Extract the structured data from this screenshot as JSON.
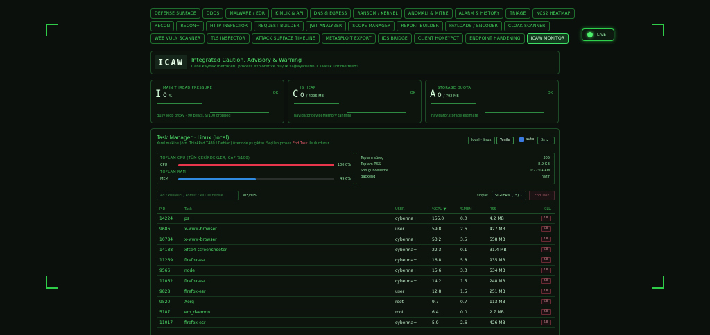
{
  "nav": {
    "rows": [
      [
        "DEFENSE SURFACE",
        "DDOS",
        "MALWARE / EDR",
        "KIMLIK & API",
        "DNS & EGRESS",
        "RANSOM / KERNEL",
        "ANOMALI & MITRE",
        "ALARM & HISTORY",
        "TRIAGE",
        "NCS2 HEATMAP"
      ],
      [
        "RECON",
        "RECON+",
        "HTTP INSPECTOR",
        "REQUEST BUILDER",
        "JWT ANALYZER",
        "SCOPE MANAGER",
        "REPORT BUILDER",
        "PAYLOADS / ENCODER",
        "CLOAK SCANNER"
      ],
      [
        "WEB VULN SCANNER",
        "TLS INSPECTOR",
        "ATTACK SURFACE TIMELINE",
        "METASPLOIT EXPORT",
        "IDS BRIDGE",
        "CLIENT HONEYPOT",
        "ENDPOINT HARDENING",
        "ICAW MONITOR"
      ]
    ],
    "active": "ICAW MONITOR"
  },
  "live": {
    "label": "LIVE"
  },
  "icaw": {
    "logo": "ICAW",
    "title": "Integrated Caution, Advisory & Warning",
    "subtitle": "Canlı kaynak metrikleri, process explorer ve büyük sağlayıcıların 1 saatlik uptime feed'i."
  },
  "gauges": [
    {
      "letter": "I",
      "label": "MAIN THREAD PRESSURE",
      "value": "0",
      "unit": "%",
      "status": "OK",
      "note": "Busy loop proxy · 90 beats, 9/100 dropped"
    },
    {
      "letter": "C",
      "label": "JS HEAP",
      "value": "0",
      "unit": "/ 4096 MB",
      "status": "OK",
      "note": "navigator.deviceMemory tahmini"
    },
    {
      "letter": "A",
      "label": "STORAGE QUOTA",
      "value": "0",
      "unit": "/ 792 MB",
      "status": "OK",
      "note": "navigator.storage.estimate"
    }
  ],
  "task_manager": {
    "title": "Task Manager · Linux (local)",
    "subtitle_pre": "Yerel makine (örn. ThinkPad T480 / Debian) üzerinde ps çıktısı. Seçilen proses ",
    "subtitle_hl": "End Task",
    "subtitle_post": " ile durdurur.",
    "source_chip": "local · linux",
    "refresh_btn": "Yenile",
    "auto_label": "auto",
    "interval": "3s",
    "totals": {
      "cpu_head": "TOPLAM CPU (TÜM ÇEKİRDEKLER, CAP %100)",
      "cpu_label": "CPU",
      "cpu_pct": 100.0,
      "cpu_text": "100.0%",
      "ram_head": "TOPLAM RAM",
      "ram_label": "MEM",
      "ram_pct": 49.6,
      "ram_text": "49.6%",
      "cpu_color": "#e8364d",
      "ram_color": "#2f8ae0"
    },
    "stats": [
      {
        "label": "Toplam süreç",
        "value": "305"
      },
      {
        "label": "Toplam RSS",
        "value": "8.9 GB"
      },
      {
        "label": "Son güncelleme",
        "value": "1:22:14 AM"
      },
      {
        "label": "Backend",
        "value": "hazır"
      }
    ],
    "filter_placeholder": "Ad / kullanıcı / komut / PID ile filtrele",
    "count": "305/305",
    "signal_label": "sinyal:",
    "signal_value": "SIGTERM (15)",
    "end_task": "End Task",
    "columns": {
      "pid": "PID",
      "task": "Task",
      "user": "USER",
      "cpu": "%CPU ▼",
      "mem": "%MEM",
      "rss": "RSS",
      "kill": "KILL"
    },
    "kill_label": "Kill",
    "rows": [
      {
        "pid": "14224",
        "task": "ps",
        "user": "cyberma+",
        "cpu": "155.0",
        "mem": "0.0",
        "rss": "4.2 MB"
      },
      {
        "pid": "9686",
        "task": "x-www-browser",
        "user": "user",
        "cpu": "59.8",
        "mem": "2.6",
        "rss": "427 MB"
      },
      {
        "pid": "10784",
        "task": "x-www-browser",
        "user": "cyberma+",
        "cpu": "53.2",
        "mem": "3.5",
        "rss": "558 MB"
      },
      {
        "pid": "14188",
        "task": "xfce4-screenshooter",
        "user": "cyberma+",
        "cpu": "22.3",
        "mem": "0.1",
        "rss": "31.4 MB"
      },
      {
        "pid": "11269",
        "task": "firefox-esr",
        "user": "cyberma+",
        "cpu": "16.8",
        "mem": "5.8",
        "rss": "935 MB"
      },
      {
        "pid": "9566",
        "task": "node",
        "user": "cyberma+",
        "cpu": "15.6",
        "mem": "3.3",
        "rss": "534 MB"
      },
      {
        "pid": "11062",
        "task": "firefox-esr",
        "user": "cyberma+",
        "cpu": "14.2",
        "mem": "1.5",
        "rss": "248 MB"
      },
      {
        "pid": "9828",
        "task": "firefox-esr",
        "user": "user",
        "cpu": "12.8",
        "mem": "1.5",
        "rss": "251 MB"
      },
      {
        "pid": "9520",
        "task": "Xorg",
        "user": "root",
        "cpu": "9.7",
        "mem": "0.7",
        "rss": "113 MB"
      },
      {
        "pid": "5187",
        "task": "em_daemon",
        "user": "root",
        "cpu": "6.4",
        "mem": "0.0",
        "rss": "2.7 MB"
      },
      {
        "pid": "11017",
        "task": "firefox-esr",
        "user": "cyberma+",
        "cpu": "5.9",
        "mem": "2.6",
        "rss": "426 MB"
      }
    ]
  }
}
